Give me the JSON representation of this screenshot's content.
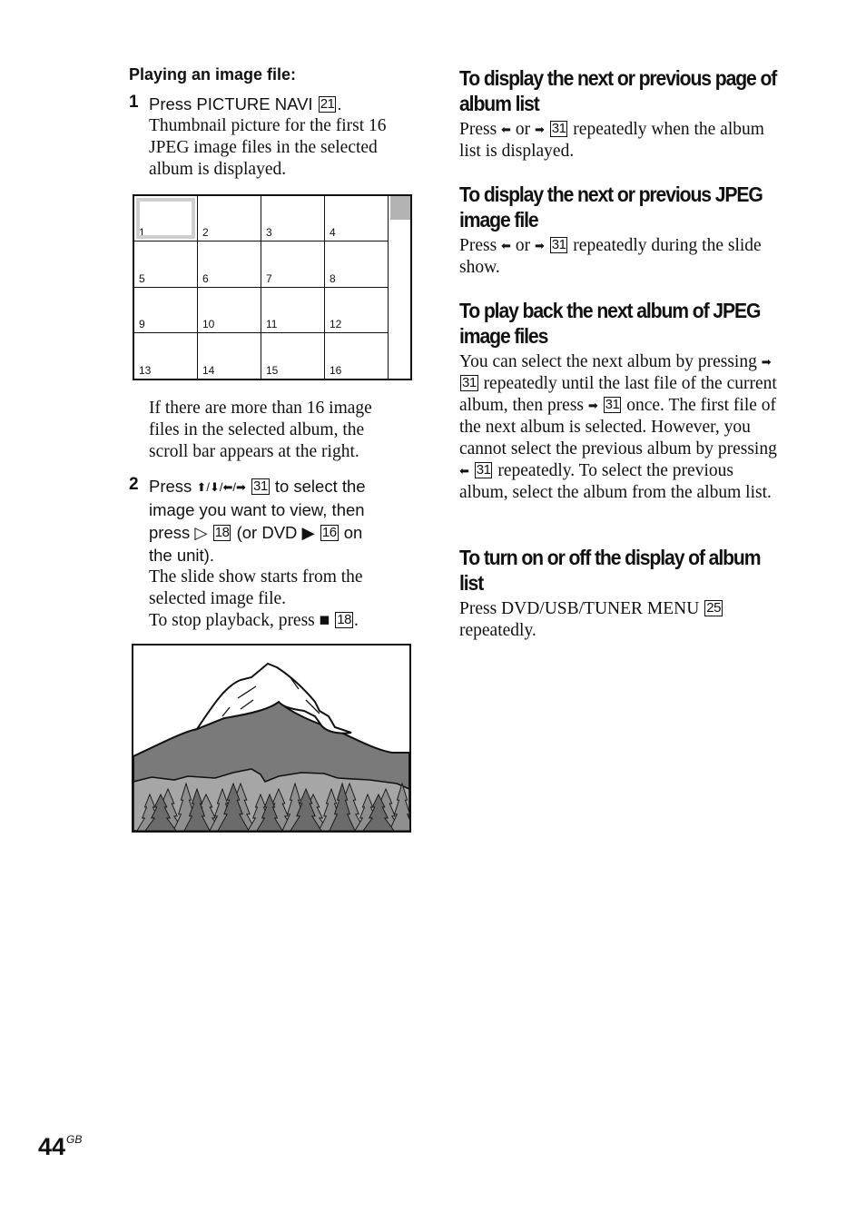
{
  "page": {
    "number": "44",
    "region_code": "GB"
  },
  "left": {
    "subheading": "Playing an image file:",
    "step1": {
      "number": "1",
      "instruction_prefix": "Press PICTURE NAVI",
      "instruction_key": "21",
      "instruction_suffix": ".",
      "description": [
        "Thumbnail picture for the first 16",
        "JPEG image files in the selected",
        "album is displayed."
      ]
    },
    "thumbnail_grid": {
      "cells": [
        "1",
        "2",
        "3",
        "4",
        "5",
        "6",
        "7",
        "8",
        "9",
        "10",
        "11",
        "12",
        "13",
        "14",
        "15",
        "16"
      ],
      "selected_index": 0
    },
    "note": [
      "If there are more than 16 image",
      "files in the selected album, the",
      "scroll bar appears at the right."
    ],
    "step2": {
      "number": "2",
      "line1_prefix": "Press",
      "arrows": "⬆/⬇/⬅/➡",
      "line1_key": "31",
      "line1_suffix": "to select the",
      "line2": "image you want to view, then",
      "line3_prefix": "press",
      "play_outline_symbol": "▷",
      "line3_key1": "18",
      "line3_mid": "(or DVD",
      "play_solid_symbol": "▶",
      "line3_key2": "16",
      "line3_suffix": "on",
      "line4": "the unit).",
      "desc1": "The slide show starts from the",
      "desc2": "selected image file.",
      "stop_prefix": "To stop playback, press",
      "stop_symbol": "■",
      "stop_key": "18",
      "stop_suffix": "."
    }
  },
  "right": {
    "sections": [
      {
        "heading": "To display the next or previous page of album list",
        "body_prefix": "Press",
        "left_arrow": "⬅",
        "or": "or",
        "right_arrow": "➡",
        "key": "31",
        "body_suffix": "repeatedly when the album list is displayed."
      },
      {
        "heading": "To display the next or previous JPEG image file",
        "body_prefix": "Press",
        "left_arrow": "⬅",
        "or": "or",
        "right_arrow": "➡",
        "key": "31",
        "body_suffix": "repeatedly during the slide show."
      },
      {
        "heading": "To play back the next album of JPEG image files",
        "p1": "You can select the next album by pressing",
        "right_arrow": "➡",
        "key": "31",
        "p2": "repeatedly until the last file of the current album, then press",
        "p3": "once.",
        "p4": "The first file of the next album is selected. However, you cannot select the previous album by pressing",
        "left_arrow": "⬅",
        "p5": "repeatedly. To select the previous album, select the album from the album list."
      },
      {
        "heading": "To turn on or off the display of album list",
        "body_prefix": "Press DVD/USB/TUNER MENU",
        "key": "25",
        "body_suffix": "repeatedly."
      }
    ]
  },
  "colors": {
    "text": "#111111",
    "selection_frame": "#cfcfcf",
    "scroll_thumb": "#b3b3b3",
    "mountain_dark": "#7a7a7a",
    "foothills": "#a6a6a6",
    "trees_light": "#8f8f8f",
    "trees_dark": "#6b6b6b"
  }
}
